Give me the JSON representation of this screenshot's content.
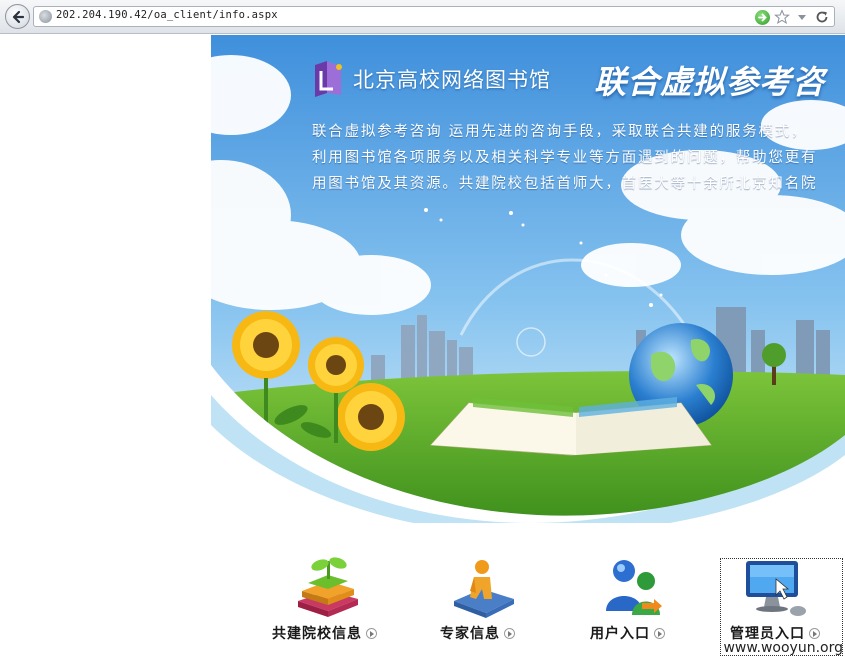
{
  "browser": {
    "url": "202.204.190.42/oa_client/info.aspx"
  },
  "banner": {
    "brand_name": "北京高校网络图书馆",
    "slogan": "联合虚拟参考咨",
    "intro_lines": [
      "联合虚拟参考咨询 运用先进的咨询手段，采取联合共建的服务模式，",
      "利用图书馆各项服务以及相关科学专业等方面遇到的问题，帮助您更有",
      "用图书馆及其资源。共建院校包括首师大，首医大等十余所北京知名院"
    ]
  },
  "menu": {
    "items": [
      {
        "label": "共建院校信息",
        "icon": "books-sprout-icon"
      },
      {
        "label": "专家信息",
        "icon": "expert-reader-icon"
      },
      {
        "label": "用户入口",
        "icon": "users-icon"
      },
      {
        "label": "管理员入口",
        "icon": "monitor-mouse-icon"
      }
    ]
  },
  "watermark": "www.wooyun.org",
  "colors": {
    "sky_top": "#4a9be0",
    "grass": "#5aaa2a",
    "accent_green": "#2f9b26"
  }
}
